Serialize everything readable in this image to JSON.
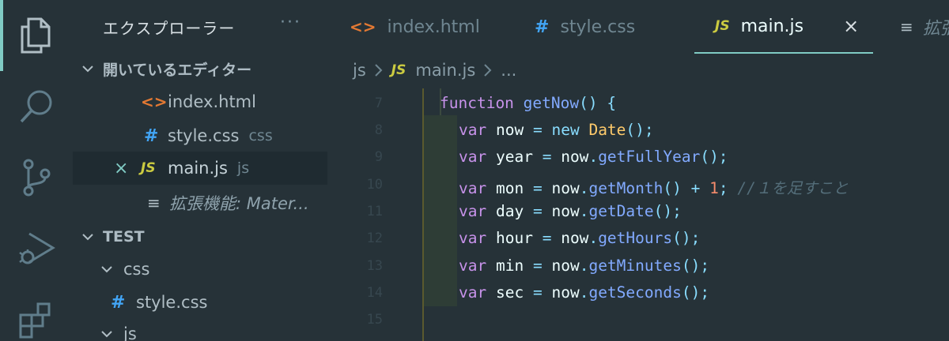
{
  "activity_bar": {
    "items": [
      {
        "name": "explorer-icon",
        "active": true
      },
      {
        "name": "search-icon",
        "active": false
      },
      {
        "name": "source-control-icon",
        "active": false
      },
      {
        "name": "run-debug-icon",
        "active": false
      },
      {
        "name": "extensions-icon",
        "active": false
      }
    ]
  },
  "sidebar": {
    "title": "エクスプローラー",
    "more": "···",
    "open_editors": {
      "label": "開いているエディター",
      "items": [
        {
          "icon": "<>",
          "name": "index.html",
          "hint": ""
        },
        {
          "icon": "#",
          "name": "style.css",
          "hint": "css"
        },
        {
          "icon": "JS",
          "name": "main.js",
          "hint": "js",
          "close": "×"
        },
        {
          "icon": "≡",
          "name": "拡張機能: Mater..."
        }
      ]
    },
    "workspace": {
      "label": "TEST",
      "folders": [
        {
          "name": "css",
          "files": [
            {
              "icon": "#",
              "name": "style.css"
            }
          ]
        },
        {
          "name": "js"
        }
      ]
    }
  },
  "tabs": [
    {
      "icon": "<>",
      "label": "index.html",
      "active": false
    },
    {
      "icon": "#",
      "label": "style.css",
      "active": false
    },
    {
      "icon": "JS",
      "label": "main.js",
      "active": true,
      "close": "×"
    },
    {
      "icon": "≡",
      "label": "拡張",
      "active": false
    }
  ],
  "breadcrumb": {
    "folder": "js",
    "file_icon": "JS",
    "file": "main.js",
    "ellipsis": "..."
  },
  "editor": {
    "lines": [
      {
        "no": "7",
        "code": "function getNow() {"
      },
      {
        "no": "8",
        "code": "var now = new Date();"
      },
      {
        "no": "9",
        "code": "var year = now.getFullYear();"
      },
      {
        "no": "10",
        "code": "var mon = now.getMonth() + 1; //１を足すこと"
      },
      {
        "no": "11",
        "code": "var day = now.getDate();"
      },
      {
        "no": "12",
        "code": "var hour = now.getHours();"
      },
      {
        "no": "13",
        "code": "var min = now.getMinutes();"
      },
      {
        "no": "14",
        "code": "var sec = now.getSeconds();"
      },
      {
        "no": "15",
        "code": ""
      }
    ],
    "tokens": {
      "function": "function",
      "getNow": "getNow",
      "var": "var",
      "new": "new",
      "Date": "Date",
      "now": "now",
      "year": "year",
      "mon": "mon",
      "day": "day",
      "hour": "hour",
      "min": "min",
      "sec": "sec",
      "getFullYear": "getFullYear",
      "getMonth": "getMonth",
      "getDate": "getDate",
      "getHours": "getHours",
      "getMinutes": "getMinutes",
      "getSeconds": "getSeconds",
      "one": "1",
      "comment": "//１を足すこと"
    }
  },
  "colors": {
    "background": "#263238",
    "accent": "#80cbc4",
    "keyword": "#c792ea",
    "function": "#82aaff",
    "class": "#ffcb6b",
    "number": "#f78c6c",
    "operator": "#89ddff",
    "comment": "#546e7a"
  }
}
